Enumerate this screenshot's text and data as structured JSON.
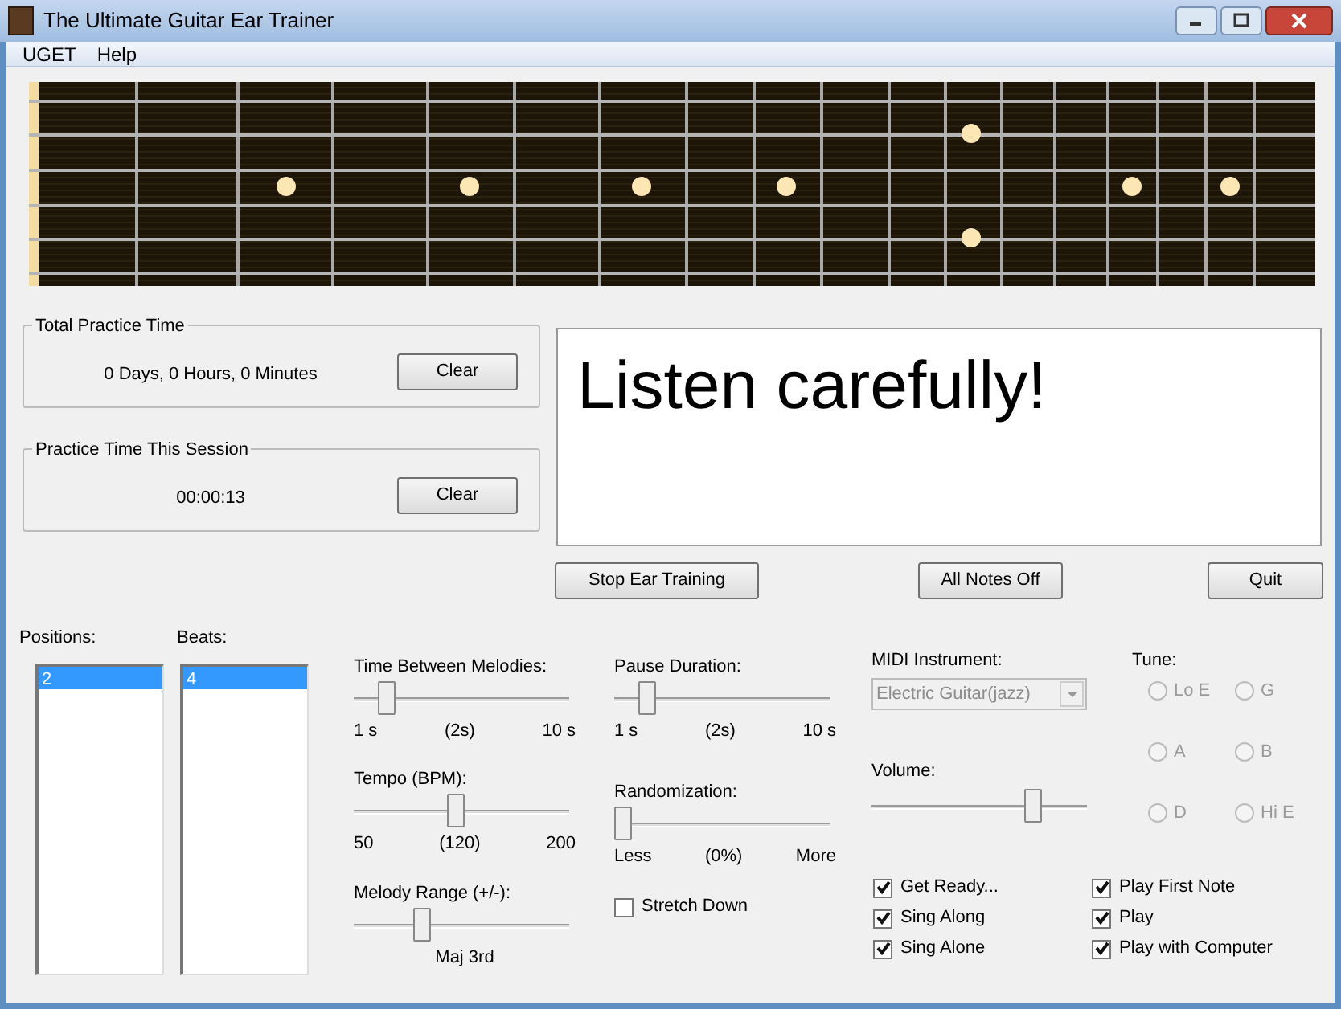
{
  "window": {
    "title": "The Ultimate Guitar Ear Trainer"
  },
  "menu": [
    "UGET",
    "Help"
  ],
  "total_practice": {
    "title": "Total Practice Time",
    "value": "0 Days, 0 Hours, 0 Minutes",
    "button": "Clear"
  },
  "session_practice": {
    "title": "Practice Time This Session",
    "value": "00:00:13",
    "button": "Clear"
  },
  "display": {
    "text": "Listen carefully!"
  },
  "buttons": [
    "Stop Ear Training",
    "All Notes Off",
    "Quit"
  ],
  "positions": {
    "label": "Positions:",
    "items": [
      {
        "text": "2",
        "selected": true
      }
    ]
  },
  "beats": {
    "label": "Beats:",
    "items": [
      {
        "text": "4",
        "selected": true
      }
    ]
  },
  "sliders": [
    {
      "label": "Time Between Melodies:",
      "level": 0.12,
      "min": "1 s",
      "value": "(2s)",
      "max": "10 s"
    },
    {
      "label": "Pause Duration:",
      "level": 0.12,
      "min": "1 s",
      "value": "(2s)",
      "max": "10 s"
    },
    {
      "label": "Tempo (BPM):",
      "level": 0.47,
      "min": "50",
      "value": "(120)",
      "max": "200"
    },
    {
      "label": "Randomization:",
      "level": 0,
      "min": "Less",
      "value": "(0%)",
      "max": "More"
    },
    {
      "label": "Melody Range (+/-):",
      "level": 0.3,
      "value": "Maj 3rd"
    }
  ],
  "stretch_down": {
    "label": "Stretch Down",
    "checked": false
  },
  "midi_instrument": {
    "label": "MIDI Instrument:",
    "value": "Electric Guitar(jazz)",
    "disabled": true
  },
  "volume": {
    "label": "Volume:",
    "level": 0.77
  },
  "tune": {
    "label": "Tune:",
    "options": [
      {
        "label": "Lo E",
        "selected": false,
        "disabled": true
      },
      {
        "label": "G",
        "selected": false,
        "disabled": true
      },
      {
        "label": "A",
        "selected": false,
        "disabled": true
      },
      {
        "label": "B",
        "selected": false,
        "disabled": true
      },
      {
        "label": "D",
        "selected": false,
        "disabled": true
      },
      {
        "label": "Hi E",
        "selected": false,
        "disabled": true
      }
    ]
  },
  "checkboxes": [
    {
      "label": "Get Ready...",
      "checked": true
    },
    {
      "label": "Play First Note",
      "checked": true
    },
    {
      "label": "Sing Along",
      "checked": true
    },
    {
      "label": "Play",
      "checked": true
    },
    {
      "label": "Sing Alone",
      "checked": true
    },
    {
      "label": "Play with Computer",
      "checked": true
    }
  ]
}
